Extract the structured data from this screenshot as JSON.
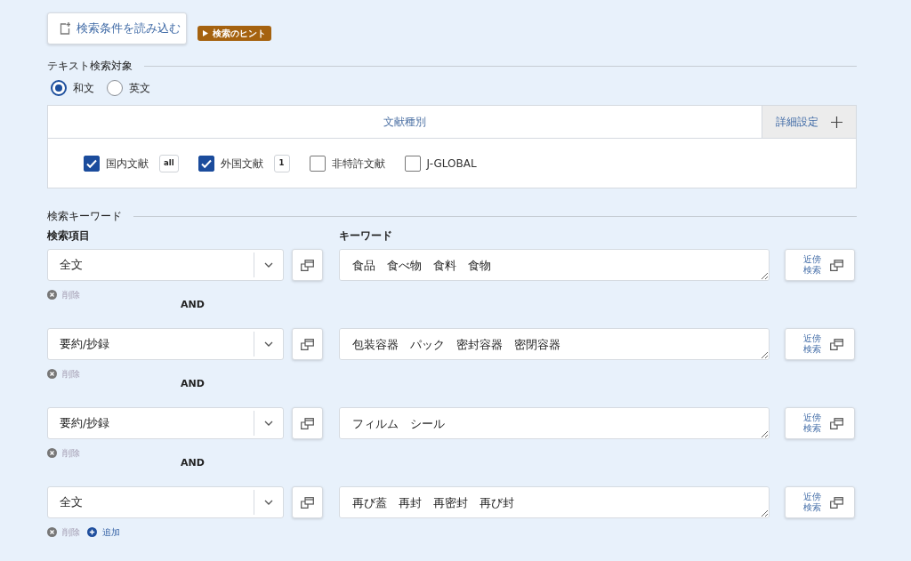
{
  "load_button": {
    "label": "検索条件を読み込む"
  },
  "hint_toggle": {
    "label": "検索のヒント"
  },
  "text_target": {
    "heading": "テキスト検索対象",
    "options": [
      {
        "label": "和文",
        "selected": true
      },
      {
        "label": "英文",
        "selected": false
      }
    ]
  },
  "document_types": {
    "title": "文献種別",
    "detail_button": "詳細設定",
    "items": [
      {
        "label": "国内文献",
        "checked": true,
        "count": "all"
      },
      {
        "label": "外国文献",
        "checked": true,
        "count": "1"
      },
      {
        "label": "非特許文献",
        "checked": false
      },
      {
        "label": "J-GLOBAL",
        "checked": false
      }
    ]
  },
  "keywords": {
    "heading": "検索キーワード",
    "field_label": "検索項目",
    "keyword_label": "キーワード",
    "rows": [
      {
        "field": "全文",
        "keywords": "食品　食べ物　食料　食物",
        "proximity_button": "近傍検索",
        "delete": "削除",
        "operator": "AND"
      },
      {
        "field": "要約/抄録",
        "keywords": "包装容器　パック　密封容器　密閉容器",
        "proximity_button": "近傍検索",
        "delete": "削除",
        "operator": "AND"
      },
      {
        "field": "要約/抄録",
        "keywords": "フィルム　シール",
        "proximity_button": "近傍検索",
        "delete": "削除",
        "operator": "AND"
      },
      {
        "field": "全文",
        "keywords": "再び蓋　再封　再密封　再び封",
        "proximity_button": "近傍検索",
        "delete": "削除",
        "add": "追加"
      }
    ]
  }
}
